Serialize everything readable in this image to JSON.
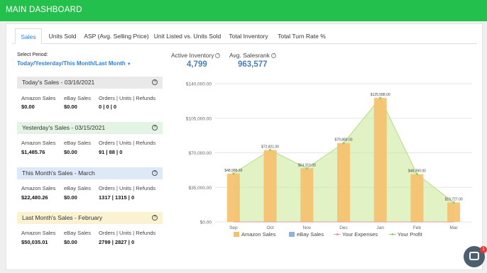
{
  "topbar": {
    "title": "MAIN DASHBOARD"
  },
  "tabs": [
    {
      "label": "Sales"
    },
    {
      "label": "Units Sold"
    },
    {
      "label": "ASP (Avg. Selling Price)"
    },
    {
      "label": "Unit Listed vs. Units Sold"
    },
    {
      "label": "Total Inventory"
    },
    {
      "label": "Total Turn Rate %"
    }
  ],
  "period": {
    "label": "Select Period:",
    "value": "Today/Yesterday/This Month/Last Month"
  },
  "metrics": {
    "active_inventory": {
      "label": "Active Inventory",
      "value": "4,799"
    },
    "avg_salesrank": {
      "label": "Avg. Salesrank",
      "value": "963,577"
    }
  },
  "panels": [
    {
      "title": "Today's Sales - 03/16/2021",
      "amazon": "$0.00",
      "ebay": "$0.00",
      "orders": "0",
      "units": "0",
      "refunds": "0"
    },
    {
      "title": "Yesterday's Sales - 03/15/2021",
      "amazon": "$1,485.76",
      "ebay": "$0.00",
      "orders": "91",
      "units": "88",
      "refunds": "0"
    },
    {
      "title": "This Month's Sales - March",
      "amazon": "$22,480.26",
      "ebay": "$0.00",
      "orders": "1317",
      "units": "1315",
      "refunds": "0"
    },
    {
      "title": "Last Month's Sales - February",
      "amazon": "$50,035.01",
      "ebay": "$0.00",
      "orders": "2799",
      "units": "2827",
      "refunds": "0"
    }
  ],
  "panel_columns": {
    "amazon": "Amazon Sales",
    "ebay": "eBay Sales",
    "orders": "Orders | Units | Refunds"
  },
  "chart_data": {
    "type": "bar",
    "categories": [
      "Sep",
      "Oct",
      "Nov",
      "Dec",
      "Jan",
      "Feb",
      "Mar"
    ],
    "series": [
      {
        "name": "Amazon Sales",
        "type": "bar",
        "values": [
          48988,
          72821,
          54310,
          79889,
          125588,
          48390,
          19727
        ]
      },
      {
        "name": "eBay Sales",
        "type": "bar",
        "values": [
          0,
          0,
          0,
          0,
          0,
          0,
          0
        ]
      },
      {
        "name": "Your Expenses",
        "type": "line",
        "values": [
          0,
          0,
          0,
          0,
          0,
          0,
          0
        ]
      },
      {
        "name": "Your Profit",
        "type": "area",
        "values": [
          48988,
          72821,
          54310,
          79889,
          125588,
          48390,
          19727
        ]
      }
    ],
    "data_labels": [
      "$48,988.00",
      "$72,821.00",
      "$54,310.00",
      "$79,889.00",
      "$125,588.00",
      "$48,390.00",
      "$19,727.00"
    ],
    "y_ticks": [
      "$0.00",
      "$35,000.00",
      "$70,000.00",
      "$105,000.00",
      "$140,000.00"
    ],
    "ylim": [
      0,
      140000
    ],
    "legend_position": "bottom",
    "grid": true,
    "colors": {
      "amazon": "#f5c06b",
      "ebay": "#8fb3dc",
      "expenses": "#e89aa0",
      "profit": "#9ccc65"
    }
  },
  "chat": {
    "badge": "1"
  }
}
